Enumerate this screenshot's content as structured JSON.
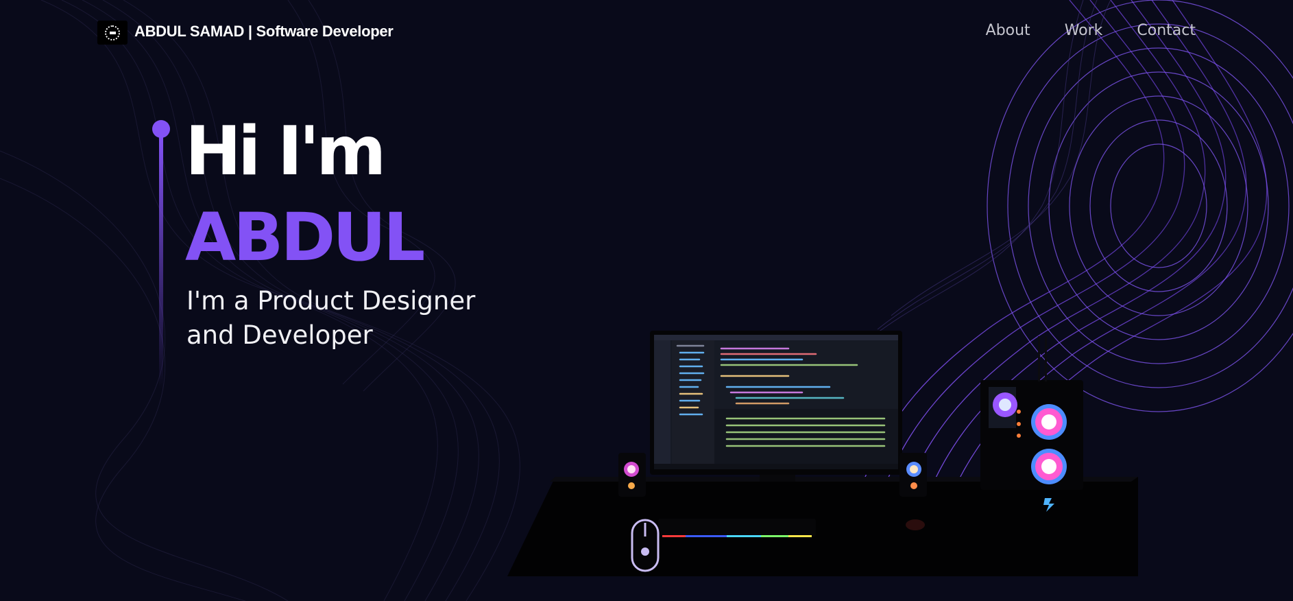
{
  "nav": {
    "brand_name": "ABDUL SAMAD",
    "brand_role": "| Software Developer",
    "links": [
      {
        "label": "About"
      },
      {
        "label": "Work"
      },
      {
        "label": "Contact"
      }
    ]
  },
  "hero": {
    "greeting": "Hi I'm",
    "name": "ABDUL",
    "subtitle_line1": "I'm a Product Designer",
    "subtitle_line2": "and Developer"
  },
  "icons": [
    "logo-icon",
    "timeline-dot-icon"
  ],
  "colors": {
    "background": "#090a1a",
    "accent": "#8352f5",
    "text": "#ffffff",
    "nav_text": "#c6c6cf"
  }
}
